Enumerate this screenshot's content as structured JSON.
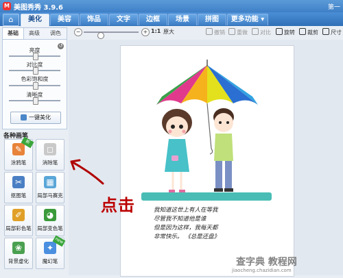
{
  "app": {
    "title": "美图秀秀 3.9.6",
    "logo_glyph": "M",
    "corner_text": "第一"
  },
  "home_glyph": "⌂",
  "tabs": [
    {
      "label": "美化",
      "active": true
    },
    {
      "label": "美容"
    },
    {
      "label": "饰品"
    },
    {
      "label": "文字"
    },
    {
      "label": "边框"
    },
    {
      "label": "场景"
    },
    {
      "label": "拼图"
    },
    {
      "label": "更多功能 ▾"
    }
  ],
  "left_panel": {
    "subtabs": [
      "基础",
      "高级",
      "调色"
    ],
    "sliders": [
      {
        "label": "亮度",
        "value": 0.5
      },
      {
        "label": "对比度",
        "value": 0.5
      },
      {
        "label": "色彩饱和度",
        "value": 0.5
      },
      {
        "label": "清晰度",
        "value": 0.5
      }
    ],
    "one_key_label": "一键美化"
  },
  "brushes": {
    "heading": "各种画笔",
    "items": [
      {
        "label": "涂鸦笔",
        "color": "#e8833a",
        "glyph": "✎",
        "badge": ""
      },
      {
        "label": "消除笔",
        "color": "#c9c9c9",
        "glyph": "◻",
        "badge": ""
      },
      {
        "label": "抠图笔",
        "color": "#4b7fc4",
        "glyph": "✂",
        "badge": ""
      },
      {
        "label": "局部马赛克",
        "color": "#5aa6d8",
        "glyph": "▦",
        "badge": ""
      },
      {
        "label": "局部彩色笔",
        "color": "#e0a028",
        "glyph": "✐",
        "badge": ""
      },
      {
        "label": "局部变色笔",
        "color": "#3a9a3a",
        "glyph": "◕",
        "badge": ""
      },
      {
        "label": "背景虚化",
        "color": "#4aa050",
        "glyph": "❀",
        "badge": ""
      },
      {
        "label": "魔幻笔",
        "color": "#4b8fe0",
        "glyph": "✦",
        "badge": "new"
      }
    ]
  },
  "toolbar": {
    "zoom_minus": "−",
    "zoom_plus": "+",
    "actual_size_ratio": "1:1",
    "actual_size_label": "原大",
    "undo": "撤销",
    "redo": "重做",
    "compare": "对比",
    "rotate": "旋转",
    "crop": "裁剪",
    "resize": "尺寸"
  },
  "photo_caption": [
    "我知道这世上有人在等我",
    "尽管我不知道他是谁",
    "但是因为这样，我每天都",
    "非常快乐。  《总是还盘》"
  ],
  "annotation": "点击",
  "watermark": {
    "line1": "查字典 教程网",
    "line2": "jiaocheng.chazidian.com"
  },
  "colors": {
    "accent_red": "#b00000",
    "tab_blue": "#3c7cc4",
    "umbrella": [
      "#e13a8d",
      "#f6b21c",
      "#e3e11d",
      "#2a6fd1",
      "#34a3e0",
      "#3aa04a"
    ]
  }
}
